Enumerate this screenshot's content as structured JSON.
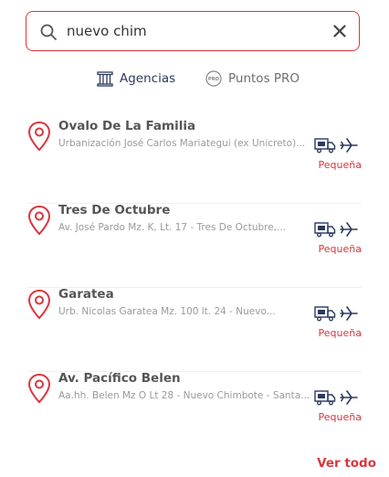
{
  "search": {
    "value": "nuevo chim",
    "clear_icon": "close-icon"
  },
  "tabs": [
    {
      "label": "Agencias",
      "icon": "building-icon",
      "active": true
    },
    {
      "label": "Puntos PRO",
      "icon": "pro-badge-icon",
      "badge_text": "PRO",
      "active": false
    }
  ],
  "agencies": [
    {
      "name": "Ovalo De La Familia",
      "address": "Urbanización José Carlos Mariategui (ex Unicreto)...",
      "size": "Pequeña"
    },
    {
      "name": "Tres De Octubre",
      "address": "Av. José Pardo Mz. K, Lt. 17 - Tres De Octubre,...",
      "size": "Pequeña"
    },
    {
      "name": "Garatea",
      "address": "Urb. Nicolas Garatea Mz. 100 lt. 24 - Nuevo...",
      "size": "Pequeña"
    },
    {
      "name": "Av. Pacífico Belen",
      "address": "Aa.hh. Belen Mz O Lt 28 - Nuevo Chimbote - Santa...",
      "size": "Pequeña"
    }
  ],
  "footer": {
    "ver_todo": "Ver todo"
  },
  "colors": {
    "accent": "#d9363e",
    "title": "#2c3a5e",
    "muted": "#9a9a9a"
  }
}
